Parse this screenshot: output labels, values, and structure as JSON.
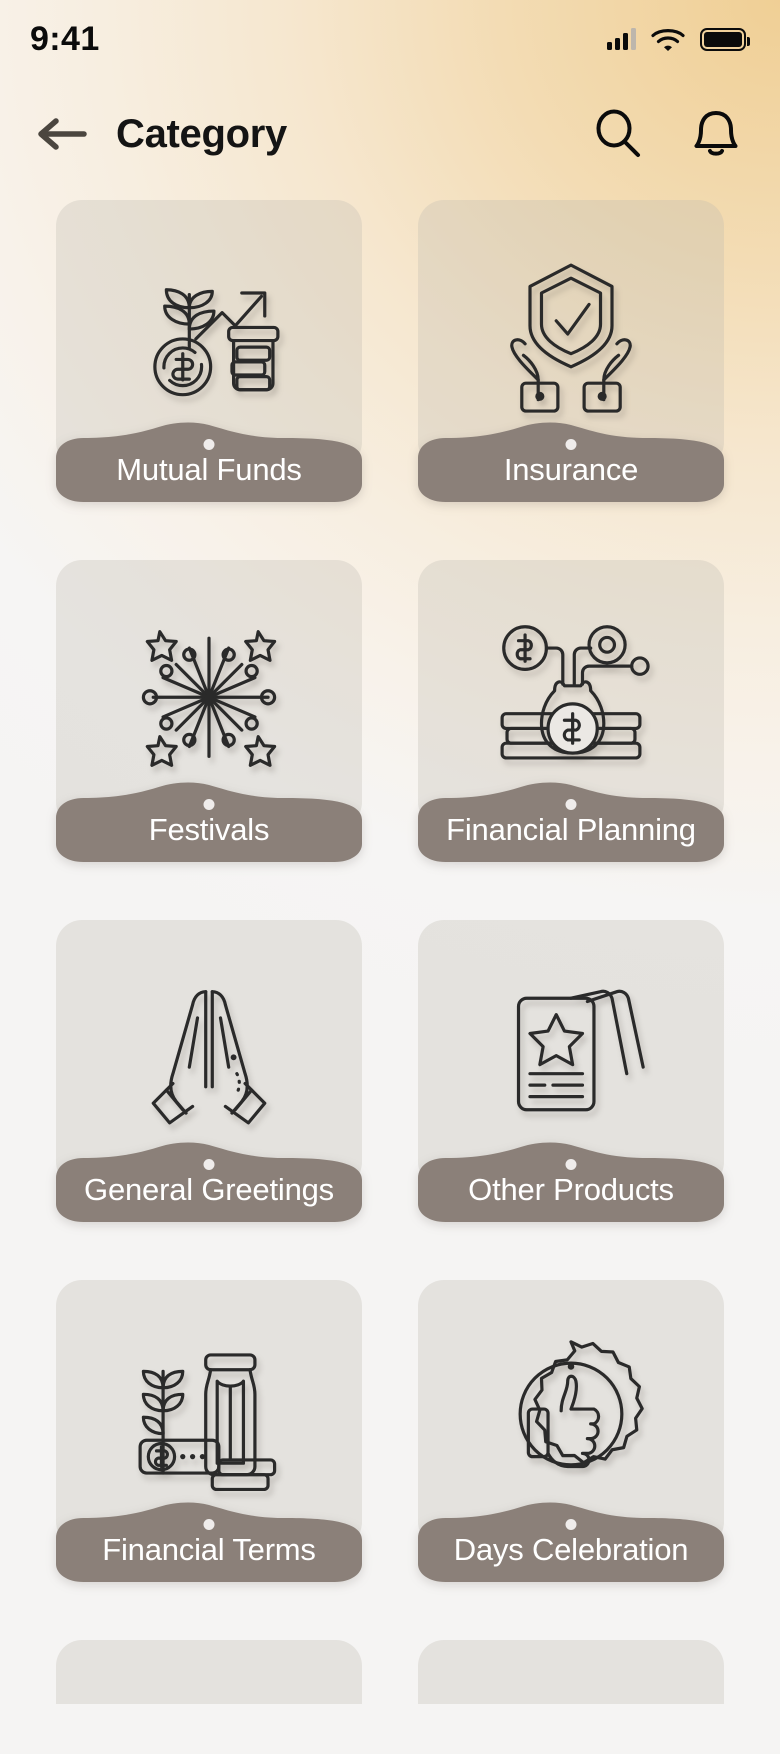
{
  "status_bar": {
    "time": "9:41",
    "signal_icon": "cellular-signal-icon",
    "wifi_icon": "wifi-icon",
    "battery_icon": "battery-full-icon"
  },
  "app_bar": {
    "back_icon": "arrow-left-icon",
    "title": "Category",
    "search_icon": "search-icon",
    "notification_icon": "bell-icon"
  },
  "colors": {
    "label_band": "#8b8079",
    "tile_background": "#beb8b0",
    "icon_stroke": "#2a2a2a",
    "accent_gradient_start": "#f0cf95",
    "accent_gradient_end": "#f3f3f4",
    "label_text": "#ffffff",
    "title_text": "#141414"
  },
  "categories": [
    {
      "label": "Mutual Funds",
      "icon": "plant-coin-growth-icon"
    },
    {
      "label": "Insurance",
      "icon": "shield-check-hands-icon"
    },
    {
      "label": "Festivals",
      "icon": "firework-sparkle-icon"
    },
    {
      "label": "Financial Planning",
      "icon": "money-bag-coins-network-icon"
    },
    {
      "label": "General Greetings",
      "icon": "praying-hands-icon"
    },
    {
      "label": "Other Products",
      "icon": "certificate-cards-icon"
    },
    {
      "label": "Financial Terms",
      "icon": "jar-plant-cash-icon"
    },
    {
      "label": "Days Celebration",
      "icon": "thumbs-up-badge-icon"
    }
  ],
  "partial_row": {
    "left_placeholder": "",
    "right_placeholder": ""
  }
}
